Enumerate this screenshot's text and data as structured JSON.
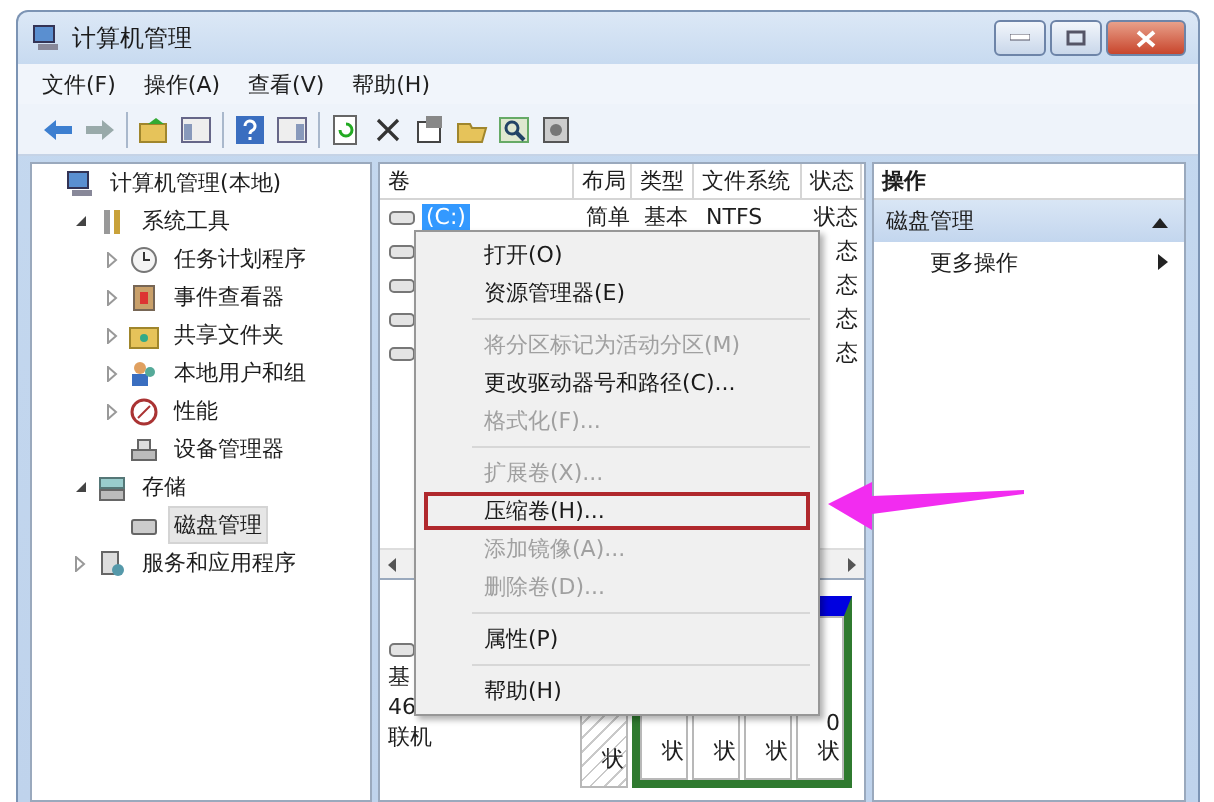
{
  "window": {
    "title": "计算机管理"
  },
  "menu_bar": [
    {
      "label": "文件(F)"
    },
    {
      "label": "操作(A)"
    },
    {
      "label": "查看(V)"
    },
    {
      "label": "帮助(H)"
    }
  ],
  "tree": {
    "label": "计算机管理(本地)",
    "kind": "computer",
    "children": [
      {
        "label": "系统工具",
        "kind": "tools",
        "expanded": true,
        "selected": false,
        "children": [
          {
            "label": "任务计划程序",
            "kind": "clock",
            "expanded": false,
            "selected": false
          },
          {
            "label": "事件查看器",
            "kind": "log",
            "expanded": false,
            "selected": false
          },
          {
            "label": "共享文件夹",
            "kind": "share",
            "expanded": false,
            "selected": false
          },
          {
            "label": "本地用户和组",
            "kind": "users",
            "expanded": false,
            "selected": false
          },
          {
            "label": "性能",
            "kind": "gauge",
            "expanded": false,
            "selected": false
          },
          {
            "label": "设备管理器",
            "kind": "device",
            "selected": false
          }
        ]
      },
      {
        "label": "存储",
        "kind": "storage",
        "expanded": true,
        "selected": false,
        "children": [
          {
            "label": "磁盘管理",
            "kind": "disk",
            "selected": true
          }
        ]
      },
      {
        "label": "服务和应用程序",
        "kind": "services",
        "expanded": false,
        "selected": false
      }
    ]
  },
  "volume_table": {
    "columns": [
      "卷",
      "布局",
      "类型",
      "文件系统",
      "状态"
    ],
    "rows": [
      {
        "volume": "(C:)",
        "layout": "简单",
        "type": "基本",
        "file_system": "NTFS",
        "status": "状态",
        "selected": true
      },
      {
        "status": "态"
      },
      {
        "status": "态"
      },
      {
        "status": "态"
      },
      {
        "status": "态"
      }
    ]
  },
  "disk_view": {
    "label_lines": [
      "基",
      "46",
      "联机"
    ],
    "partitions": [
      {
        "kind": "unallocated",
        "lines": [
          "状"
        ]
      },
      {
        "kind": "primary",
        "lines": [
          "状"
        ]
      },
      {
        "kind": "primary",
        "lines": [
          "状"
        ]
      },
      {
        "kind": "primary",
        "lines": [
          "状"
        ]
      },
      {
        "kind": "primary",
        "lines": [
          "0",
          "状"
        ]
      }
    ]
  },
  "context_menu": [
    {
      "kind": "item",
      "label": "打开(O)",
      "disabled": false,
      "highlighted": false
    },
    {
      "kind": "item",
      "label": "资源管理器(E)",
      "disabled": false,
      "highlighted": false
    },
    {
      "kind": "separator"
    },
    {
      "kind": "item",
      "label": "将分区标记为活动分区(M)",
      "disabled": true,
      "highlighted": false
    },
    {
      "kind": "item",
      "label": "更改驱动器号和路径(C)...",
      "disabled": false,
      "highlighted": false
    },
    {
      "kind": "item",
      "label": "格式化(F)...",
      "disabled": true,
      "highlighted": false
    },
    {
      "kind": "separator"
    },
    {
      "kind": "item",
      "label": "扩展卷(X)...",
      "disabled": true,
      "highlighted": false
    },
    {
      "kind": "item",
      "label": "压缩卷(H)...",
      "disabled": false,
      "highlighted": true
    },
    {
      "kind": "item",
      "label": "添加镜像(A)...",
      "disabled": true,
      "highlighted": false
    },
    {
      "kind": "item",
      "label": "删除卷(D)...",
      "disabled": true,
      "highlighted": false
    },
    {
      "kind": "separator"
    },
    {
      "kind": "item",
      "label": "属性(P)",
      "disabled": false,
      "highlighted": false
    },
    {
      "kind": "separator"
    },
    {
      "kind": "item",
      "label": "帮助(H)",
      "disabled": false,
      "highlighted": false
    }
  ],
  "actions": {
    "header": "操作",
    "section": {
      "label": "磁盘管理",
      "expanded": true
    },
    "items": [
      {
        "label": "更多操作"
      }
    ]
  }
}
